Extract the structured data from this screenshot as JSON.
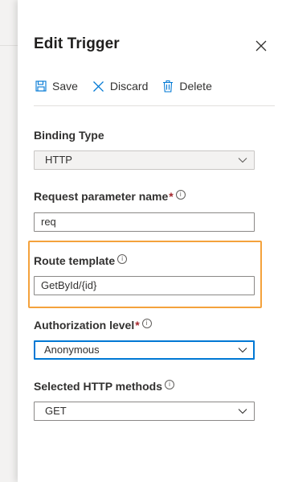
{
  "panel": {
    "title": "Edit Trigger",
    "close_icon": "close-icon"
  },
  "toolbar": {
    "save_label": "Save",
    "discard_label": "Discard",
    "delete_label": "Delete",
    "icons": [
      "save-icon",
      "discard-icon",
      "delete-icon"
    ]
  },
  "fields": {
    "binding_type": {
      "label": "Binding Type",
      "value": "HTTP"
    },
    "request_param": {
      "label": "Request parameter name",
      "required_mark": "*",
      "value": "req"
    },
    "route_template": {
      "label": "Route template",
      "value": "GetById/{id}"
    },
    "auth_level": {
      "label": "Authorization level",
      "required_mark": "*",
      "value": "Anonymous"
    },
    "http_methods": {
      "label": "Selected HTTP methods",
      "value": "GET"
    }
  },
  "colors": {
    "highlight": "#f4a23c",
    "focus": "#0078d4",
    "required": "#a4262c"
  }
}
